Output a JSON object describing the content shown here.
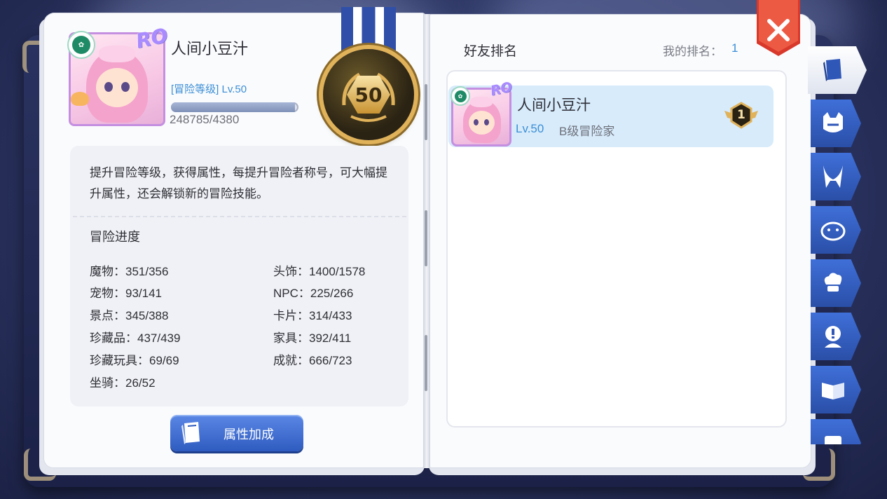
{
  "player": {
    "name": "人间小豆汁",
    "rank_label": "[冒险等级] Lv.50",
    "xp_text": "248785/4380",
    "xp_fill": 0.97,
    "medal_level": "50",
    "ro_logo": "RO"
  },
  "info": {
    "description": "提升冒险等级，获得属性，每提升冒险者称号，可大幅提升属性，还会解锁新的冒险技能。",
    "progress_title": "冒险进度",
    "stats_left": [
      "魔物：351/356",
      "宠物：93/141",
      "景点：345/388",
      "珍藏品：437/439",
      "珍藏玩具：69/69",
      "坐骑：26/52"
    ],
    "stats_right": [
      "头饰：1400/1578",
      "NPC：225/266",
      "卡片：314/433",
      "家具：392/411",
      "成就：666/723"
    ]
  },
  "attr_button": {
    "label": "属性加成"
  },
  "ranking": {
    "title": "好友排名",
    "my_rank_label": "我的排名：",
    "my_rank_value": "1",
    "friends": [
      {
        "name": "人间小豆汁",
        "level": "Lv.50",
        "title": "B级冒险家",
        "rank": "1"
      }
    ]
  },
  "tabs": [
    {
      "icon": "book-icon",
      "active": true
    },
    {
      "icon": "monster-face-icon",
      "active": false
    },
    {
      "icon": "pet-ears-icon",
      "active": false
    },
    {
      "icon": "scenery-face-icon",
      "active": false
    },
    {
      "icon": "chef-hat-icon",
      "active": false
    },
    {
      "icon": "npc-exclaim-icon",
      "active": false
    },
    {
      "icon": "open-book-icon",
      "active": false
    },
    {
      "icon": "card-icon",
      "active": false
    }
  ],
  "colors": {
    "accent_blue": "#3c8fd6",
    "tab_blue": "#2f57b8",
    "close_red": "#d8392b",
    "highlight_row": "#d7ebfb",
    "medal_gold": "#e0b25a"
  }
}
